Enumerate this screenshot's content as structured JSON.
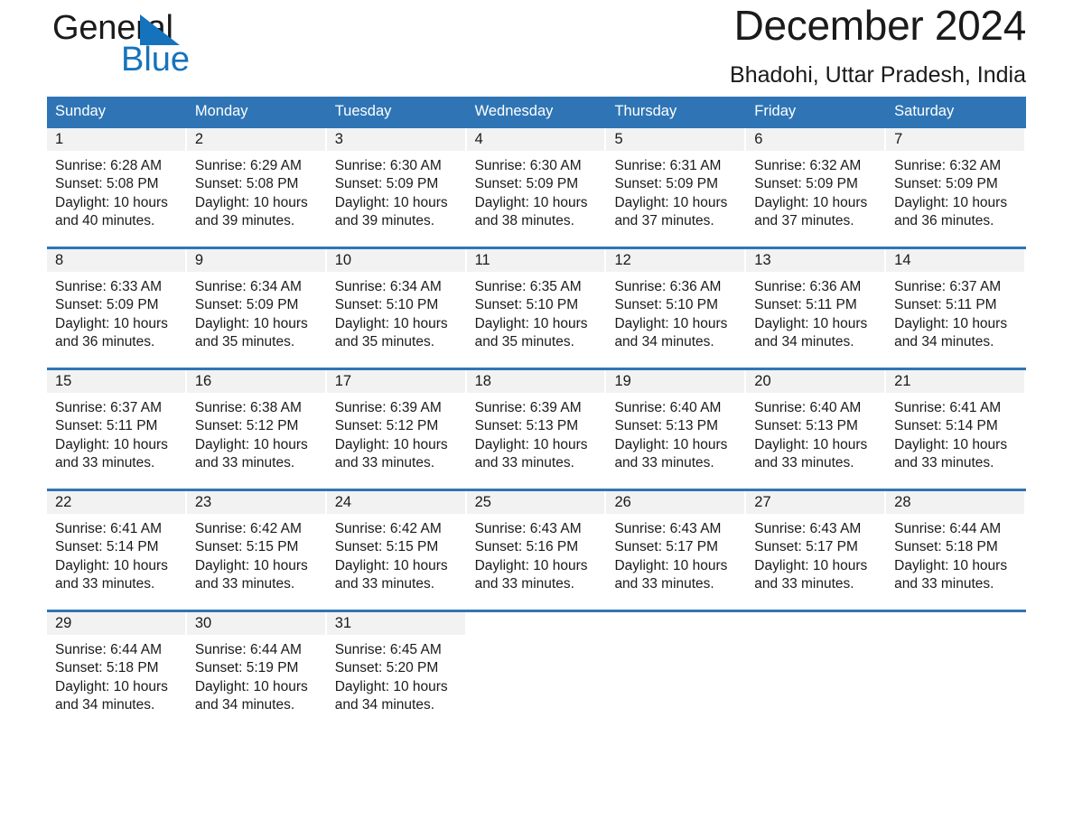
{
  "brand": {
    "word_one": "General",
    "word_two": "Blue",
    "triangle_color": "#1573bd",
    "text_color": "#1a1a1a"
  },
  "header": {
    "title": "December 2024",
    "subtitle": "Bhadohi, Uttar Pradesh, India"
  },
  "theme": {
    "header_blue": "#2f75b5",
    "daynum_band": "#f2f2f2",
    "rule_blue": "#2f75b5",
    "page_background": "#ffffff"
  },
  "weekday_headers": [
    "Sunday",
    "Monday",
    "Tuesday",
    "Wednesday",
    "Thursday",
    "Friday",
    "Saturday"
  ],
  "days": [
    {
      "date": "1",
      "sunrise": "Sunrise: 6:28 AM",
      "sunset": "Sunset: 5:08 PM",
      "daylight_line1": "Daylight: 10 hours",
      "daylight_line2": "and 40 minutes."
    },
    {
      "date": "2",
      "sunrise": "Sunrise: 6:29 AM",
      "sunset": "Sunset: 5:08 PM",
      "daylight_line1": "Daylight: 10 hours",
      "daylight_line2": "and 39 minutes."
    },
    {
      "date": "3",
      "sunrise": "Sunrise: 6:30 AM",
      "sunset": "Sunset: 5:09 PM",
      "daylight_line1": "Daylight: 10 hours",
      "daylight_line2": "and 39 minutes."
    },
    {
      "date": "4",
      "sunrise": "Sunrise: 6:30 AM",
      "sunset": "Sunset: 5:09 PM",
      "daylight_line1": "Daylight: 10 hours",
      "daylight_line2": "and 38 minutes."
    },
    {
      "date": "5",
      "sunrise": "Sunrise: 6:31 AM",
      "sunset": "Sunset: 5:09 PM",
      "daylight_line1": "Daylight: 10 hours",
      "daylight_line2": "and 37 minutes."
    },
    {
      "date": "6",
      "sunrise": "Sunrise: 6:32 AM",
      "sunset": "Sunset: 5:09 PM",
      "daylight_line1": "Daylight: 10 hours",
      "daylight_line2": "and 37 minutes."
    },
    {
      "date": "7",
      "sunrise": "Sunrise: 6:32 AM",
      "sunset": "Sunset: 5:09 PM",
      "daylight_line1": "Daylight: 10 hours",
      "daylight_line2": "and 36 minutes."
    },
    {
      "date": "8",
      "sunrise": "Sunrise: 6:33 AM",
      "sunset": "Sunset: 5:09 PM",
      "daylight_line1": "Daylight: 10 hours",
      "daylight_line2": "and 36 minutes."
    },
    {
      "date": "9",
      "sunrise": "Sunrise: 6:34 AM",
      "sunset": "Sunset: 5:09 PM",
      "daylight_line1": "Daylight: 10 hours",
      "daylight_line2": "and 35 minutes."
    },
    {
      "date": "10",
      "sunrise": "Sunrise: 6:34 AM",
      "sunset": "Sunset: 5:10 PM",
      "daylight_line1": "Daylight: 10 hours",
      "daylight_line2": "and 35 minutes."
    },
    {
      "date": "11",
      "sunrise": "Sunrise: 6:35 AM",
      "sunset": "Sunset: 5:10 PM",
      "daylight_line1": "Daylight: 10 hours",
      "daylight_line2": "and 35 minutes."
    },
    {
      "date": "12",
      "sunrise": "Sunrise: 6:36 AM",
      "sunset": "Sunset: 5:10 PM",
      "daylight_line1": "Daylight: 10 hours",
      "daylight_line2": "and 34 minutes."
    },
    {
      "date": "13",
      "sunrise": "Sunrise: 6:36 AM",
      "sunset": "Sunset: 5:11 PM",
      "daylight_line1": "Daylight: 10 hours",
      "daylight_line2": "and 34 minutes."
    },
    {
      "date": "14",
      "sunrise": "Sunrise: 6:37 AM",
      "sunset": "Sunset: 5:11 PM",
      "daylight_line1": "Daylight: 10 hours",
      "daylight_line2": "and 34 minutes."
    },
    {
      "date": "15",
      "sunrise": "Sunrise: 6:37 AM",
      "sunset": "Sunset: 5:11 PM",
      "daylight_line1": "Daylight: 10 hours",
      "daylight_line2": "and 33 minutes."
    },
    {
      "date": "16",
      "sunrise": "Sunrise: 6:38 AM",
      "sunset": "Sunset: 5:12 PM",
      "daylight_line1": "Daylight: 10 hours",
      "daylight_line2": "and 33 minutes."
    },
    {
      "date": "17",
      "sunrise": "Sunrise: 6:39 AM",
      "sunset": "Sunset: 5:12 PM",
      "daylight_line1": "Daylight: 10 hours",
      "daylight_line2": "and 33 minutes."
    },
    {
      "date": "18",
      "sunrise": "Sunrise: 6:39 AM",
      "sunset": "Sunset: 5:13 PM",
      "daylight_line1": "Daylight: 10 hours",
      "daylight_line2": "and 33 minutes."
    },
    {
      "date": "19",
      "sunrise": "Sunrise: 6:40 AM",
      "sunset": "Sunset: 5:13 PM",
      "daylight_line1": "Daylight: 10 hours",
      "daylight_line2": "and 33 minutes."
    },
    {
      "date": "20",
      "sunrise": "Sunrise: 6:40 AM",
      "sunset": "Sunset: 5:13 PM",
      "daylight_line1": "Daylight: 10 hours",
      "daylight_line2": "and 33 minutes."
    },
    {
      "date": "21",
      "sunrise": "Sunrise: 6:41 AM",
      "sunset": "Sunset: 5:14 PM",
      "daylight_line1": "Daylight: 10 hours",
      "daylight_line2": "and 33 minutes."
    },
    {
      "date": "22",
      "sunrise": "Sunrise: 6:41 AM",
      "sunset": "Sunset: 5:14 PM",
      "daylight_line1": "Daylight: 10 hours",
      "daylight_line2": "and 33 minutes."
    },
    {
      "date": "23",
      "sunrise": "Sunrise: 6:42 AM",
      "sunset": "Sunset: 5:15 PM",
      "daylight_line1": "Daylight: 10 hours",
      "daylight_line2": "and 33 minutes."
    },
    {
      "date": "24",
      "sunrise": "Sunrise: 6:42 AM",
      "sunset": "Sunset: 5:15 PM",
      "daylight_line1": "Daylight: 10 hours",
      "daylight_line2": "and 33 minutes."
    },
    {
      "date": "25",
      "sunrise": "Sunrise: 6:43 AM",
      "sunset": "Sunset: 5:16 PM",
      "daylight_line1": "Daylight: 10 hours",
      "daylight_line2": "and 33 minutes."
    },
    {
      "date": "26",
      "sunrise": "Sunrise: 6:43 AM",
      "sunset": "Sunset: 5:17 PM",
      "daylight_line1": "Daylight: 10 hours",
      "daylight_line2": "and 33 minutes."
    },
    {
      "date": "27",
      "sunrise": "Sunrise: 6:43 AM",
      "sunset": "Sunset: 5:17 PM",
      "daylight_line1": "Daylight: 10 hours",
      "daylight_line2": "and 33 minutes."
    },
    {
      "date": "28",
      "sunrise": "Sunrise: 6:44 AM",
      "sunset": "Sunset: 5:18 PM",
      "daylight_line1": "Daylight: 10 hours",
      "daylight_line2": "and 33 minutes."
    },
    {
      "date": "29",
      "sunrise": "Sunrise: 6:44 AM",
      "sunset": "Sunset: 5:18 PM",
      "daylight_line1": "Daylight: 10 hours",
      "daylight_line2": "and 34 minutes."
    },
    {
      "date": "30",
      "sunrise": "Sunrise: 6:44 AM",
      "sunset": "Sunset: 5:19 PM",
      "daylight_line1": "Daylight: 10 hours",
      "daylight_line2": "and 34 minutes."
    },
    {
      "date": "31",
      "sunrise": "Sunrise: 6:45 AM",
      "sunset": "Sunset: 5:20 PM",
      "daylight_line1": "Daylight: 10 hours",
      "daylight_line2": "and 34 minutes."
    }
  ],
  "grid": {
    "leading_blanks": 0,
    "weeks": 5,
    "columns": 7
  }
}
